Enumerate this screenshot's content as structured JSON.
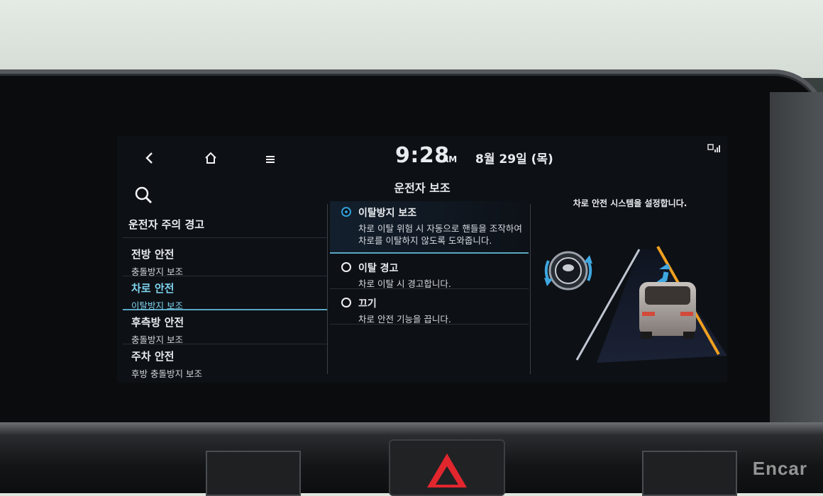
{
  "topbar": {
    "back_icon": "chevron-left-icon",
    "home_icon": "home-icon",
    "menu_icon": "menu-icon",
    "time": "9:28",
    "ampm": "AM",
    "date": "8월 29일 (목)"
  },
  "page": {
    "title": "운전자 보조",
    "search_icon": "search-icon"
  },
  "menu": {
    "top_item": "운전자 주의 경고",
    "groups": [
      {
        "heading": "전방 안전",
        "sub": "충돌방지 보조"
      },
      {
        "heading": "차로 안전",
        "sub": "이탈방지 보조"
      },
      {
        "heading": "후측방 안전",
        "sub": "충돌방지 보조"
      },
      {
        "heading": "주차 안전",
        "sub": "후방 충돌방지 보조"
      }
    ],
    "active_index": 1
  },
  "options": [
    {
      "title": "이탈방지 보조",
      "desc": "차로 이탈 위험 시 자동으로 핸들을 조작하여 차로를 이탈하지 않도록 도와줍니다.",
      "selected": true
    },
    {
      "title": "이탈 경고",
      "desc": "차로 이탈 시 경고합니다.",
      "selected": false
    },
    {
      "title": "끄기",
      "desc": "차로 안전 기능을 끕니다.",
      "selected": false
    }
  ],
  "illustration": {
    "caption": "차로 안전 시스템을 설정합니다."
  },
  "watermark": "Encar",
  "colors": {
    "accent": "#7fd5f0",
    "radio_on": "#2f9cd8",
    "lane_line": "#f0a020",
    "hazard": "#e2262e"
  }
}
